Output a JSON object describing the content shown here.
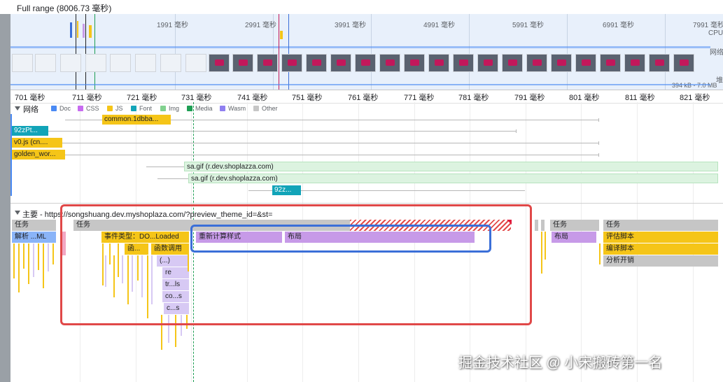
{
  "header": {
    "full_range": "Full range (8006.73 毫秒)"
  },
  "overview": {
    "ticks": [
      "1991 毫秒",
      "2991 毫秒",
      "3991 毫秒",
      "4991 毫秒",
      "5991 毫秒",
      "6991 毫秒",
      "7991 毫秒"
    ],
    "cpu_label": "CPU",
    "net_label": "网络",
    "heap_label": "堆",
    "heap_range": "394 kB - 7.0 MB"
  },
  "ruler": {
    "ticks": [
      "701 毫秒",
      "711 毫秒",
      "721 毫秒",
      "731 毫秒",
      "741 毫秒",
      "751 毫秒",
      "761 毫秒",
      "771 毫秒",
      "781 毫秒",
      "791 毫秒",
      "801 毫秒",
      "811 毫秒",
      "821 毫秒"
    ]
  },
  "network": {
    "title": "网络",
    "legend": [
      {
        "label": "Doc",
        "color": "#4a8af4"
      },
      {
        "label": "CSS",
        "color": "#c76bf0"
      },
      {
        "label": "JS",
        "color": "#f5c518"
      },
      {
        "label": "Font",
        "color": "#12a4b8"
      },
      {
        "label": "Img",
        "color": "#81d18e"
      },
      {
        "label": "Media",
        "color": "#1e9e54"
      },
      {
        "label": "Wasm",
        "color": "#8f7ff0"
      },
      {
        "label": "Other",
        "color": "#c6c6c6"
      }
    ],
    "requests": [
      "common.1dbba...",
      "92zPt...",
      "v0.js (cn....",
      "golden_wor...",
      "sa.gif (r.dev.shoplazza.com)",
      "sa.gif (r.dev.shoplazza.com)",
      "92z..."
    ]
  },
  "main": {
    "title": "主要 - https://songshuang.dev.myshoplaza.com/?preview_theme_id=&st=",
    "task": "任务",
    "parse_html": "解析 ...ML",
    "event": "事件类型：DO...Loaded",
    "func_short": "函...",
    "func_call": "函数调用",
    "anon": "(...)",
    "re": "re",
    "trls": "tr...ls",
    "cos": "co...s",
    "cs": "c...s",
    "recalc_style": "重新计算样式",
    "layout": "布局",
    "eval_script": "评估脚本",
    "compile_script": "编译脚本",
    "parse_cost": "分析开销"
  },
  "watermark": "掘金技术社区 @ 小宋搬砖第一名"
}
